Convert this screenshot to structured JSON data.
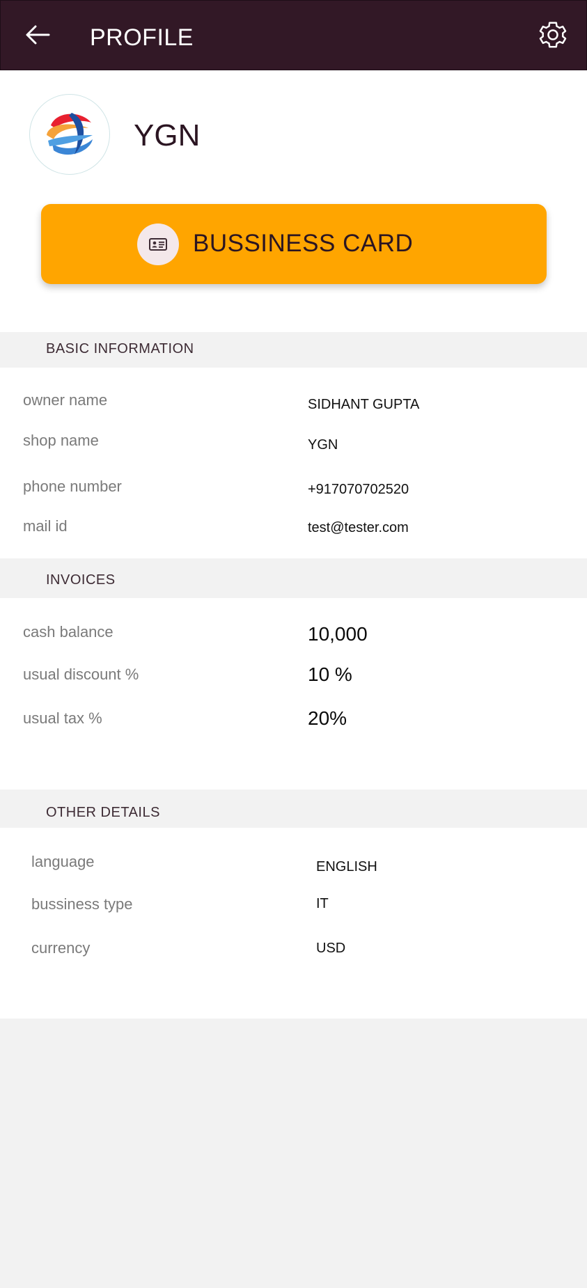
{
  "appbar": {
    "title": "PROFILE",
    "back_icon": "arrow-left-icon",
    "settings_icon": "gear-icon",
    "background": "#321826"
  },
  "profile": {
    "shop_title": "YGN",
    "logo_icon": "ribbon-logo-icon"
  },
  "business_card": {
    "label": "BUSSINESS CARD",
    "icon": "id-card-icon",
    "color": "#ffa500"
  },
  "basic_information": {
    "heading": "BASIC INFORMATION",
    "rows": [
      {
        "label": "owner name",
        "value": "SIDHANT GUPTA"
      },
      {
        "label": "shop name",
        "value": "YGN"
      },
      {
        "label": "phone number",
        "value": "+917070702520"
      },
      {
        "label": "mail id",
        "value": "test@tester.com"
      }
    ]
  },
  "invoices": {
    "heading": "INVOICES",
    "rows": [
      {
        "label": "cash balance",
        "value": "10,000"
      },
      {
        "label": "usual discount %",
        "value": "10 %"
      },
      {
        "label": "usual tax %",
        "value": "20%"
      }
    ]
  },
  "other_details": {
    "heading": "OTHER DETAILS",
    "rows": [
      {
        "label": "language",
        "value": "ENGLISH"
      },
      {
        "label": "bussiness type",
        "value": "IT"
      },
      {
        "label": "currency",
        "value": "USD"
      }
    ]
  }
}
